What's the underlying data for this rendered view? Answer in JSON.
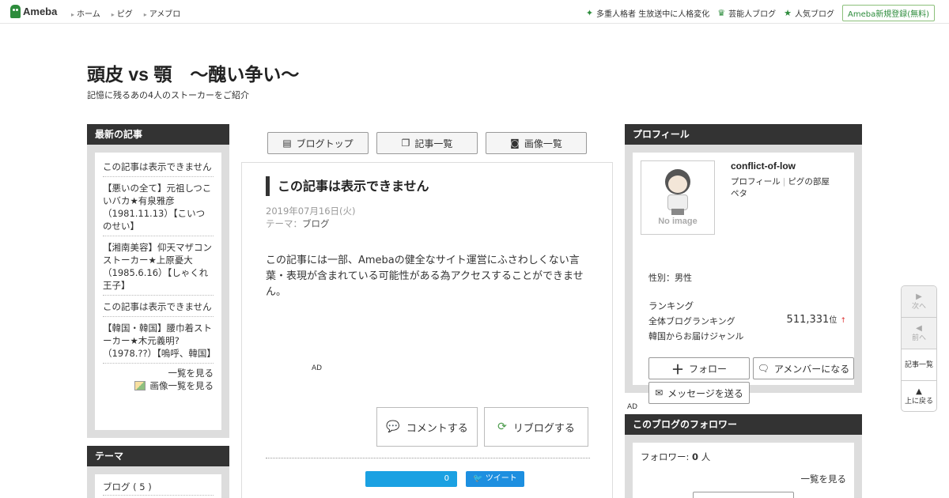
{
  "header": {
    "logo": "Ameba",
    "nav": [
      "ホーム",
      "ピグ",
      "アメブロ"
    ],
    "trends": [
      "多重人格者 生放送中に人格変化",
      "芸能人ブログ",
      "人気ブログ"
    ],
    "register": "Ameba新規登録(無料)"
  },
  "blog": {
    "title": "頭皮 vs 顎　～醜い争い～",
    "description": "記憶に残るあの4人のストーカーをご紹介"
  },
  "left": {
    "recent_heading": "最新の記事",
    "recent": [
      "この記事は表示できません",
      "【悪いの全て】元祖しつこいバカ★有泉雅彦（1981.11.13）【こいつのせい】",
      "【湘南美容】仰天マザコンストーカー★上原憂大（1985.6.16）【しゃくれ王子】",
      "この記事は表示できません",
      "【韓国・韓国】腰巾着ストーカー★木元義明?（1978.??）【嗚呼、韓国】"
    ],
    "list_more": "一覧を見る",
    "image_more": "画像一覧を見る",
    "theme_heading": "テーマ",
    "themes": [
      "ブログ ( 5 )"
    ]
  },
  "tabs": [
    {
      "label": "ブログトップ",
      "icon": "list-icon"
    },
    {
      "label": "記事一覧",
      "icon": "documents-icon"
    },
    {
      "label": "画像一覧",
      "icon": "camera-icon"
    }
  ],
  "article": {
    "title": "この記事は表示できません",
    "date": "2019年07月16日(火)",
    "theme_label": "テーマ：",
    "theme_value": "ブログ",
    "body": "この記事には一部、Amebaの健全なサイト運営にふさわしくない言葉・表現が含まれている可能性がある為アクセスすることができません。",
    "ad": "AD",
    "comment": "コメントする",
    "reblog": "リブログする",
    "like_count": "0",
    "tweet": "ツイート"
  },
  "profile": {
    "heading": "プロフィール",
    "noimage": "No image",
    "name": "conflict-of-low",
    "link_profile": "プロフィール",
    "link_room": "ピグの部屋",
    "link_peta": "ペタ",
    "gender": "性別：男性",
    "ranking_label": "ランキング",
    "ranking_all": "全体ブログランキング",
    "ranking_value": "511,331",
    "ranking_unit": "位",
    "ranking_genre": "韓国からお届けジャンル",
    "follow": "フォロー",
    "member": "アメンバーになる",
    "message": "メッセージを送る"
  },
  "right_ad": "AD",
  "followers": {
    "heading": "このブログのフォロワー",
    "label": "フォロワー: ",
    "count": "0",
    "unit": " 人",
    "more": "一覧を見る"
  },
  "floatnav": {
    "next": "次へ",
    "prev": "前へ",
    "list": "記事一覧",
    "top": "上に戻る"
  }
}
